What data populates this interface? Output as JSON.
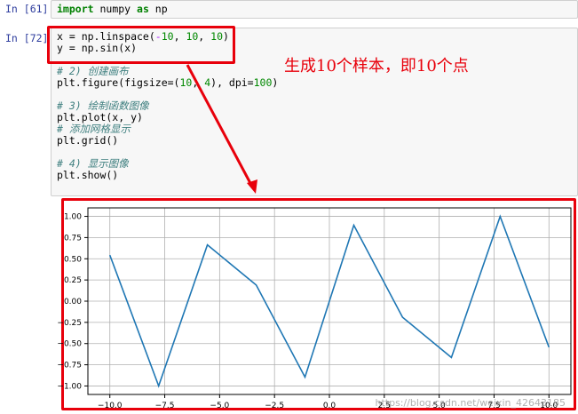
{
  "cells": [
    {
      "prompt": "In [61]:",
      "lines": [
        "import numpy as np"
      ]
    },
    {
      "prompt": "In [72]:",
      "lines": [
        "x = np.linspace(-10, 10, 10)",
        "y = np.sin(x)",
        "",
        "# 2) 创建画布",
        "plt.figure(figsize=(10, 4), dpi=100)",
        "",
        "# 3) 绘制函数图像",
        "plt.plot(x, y)",
        "# 添加网格显示",
        "plt.grid()",
        "",
        "# 4) 显示图像",
        "plt.show()"
      ]
    }
  ],
  "annotation": "生成10个样本，即10个点",
  "watermark": "https://blog.csdn.net/weixin_42643185",
  "colors": {
    "highlight": "#e8000b",
    "line": "#1f77b4"
  },
  "chart_data": {
    "type": "line",
    "title": "",
    "xlabel": "",
    "ylabel": "",
    "xlim": [
      -11,
      11
    ],
    "ylim": [
      -1.1,
      1.1
    ],
    "grid": true,
    "x_ticks": [
      -10.0,
      -7.5,
      -5.0,
      -2.5,
      0.0,
      2.5,
      5.0,
      7.5,
      10.0
    ],
    "x_tick_labels": [
      "−10.0",
      "−7.5",
      "−5.0",
      "−2.5",
      "0.0",
      "2.5",
      "5.0",
      "7.5",
      "10.0"
    ],
    "y_ticks": [
      1.0,
      0.75,
      0.5,
      0.25,
      0.0,
      -0.25,
      -0.5,
      -0.75,
      -1.0
    ],
    "y_tick_labels": [
      "1.00",
      "0.75",
      "0.50",
      "0.25",
      "0.00",
      "−0.25",
      "−0.50",
      "−0.75",
      "−1.00"
    ],
    "series": [
      {
        "x": [
          -10.0,
          -7.778,
          -5.556,
          -3.333,
          -1.111,
          1.111,
          3.333,
          5.556,
          7.778,
          10.0
        ],
        "y": [
          0.544,
          -0.999,
          0.664,
          0.19,
          -0.896,
          0.896,
          -0.19,
          -0.664,
          0.999,
          -0.544
        ]
      }
    ]
  }
}
